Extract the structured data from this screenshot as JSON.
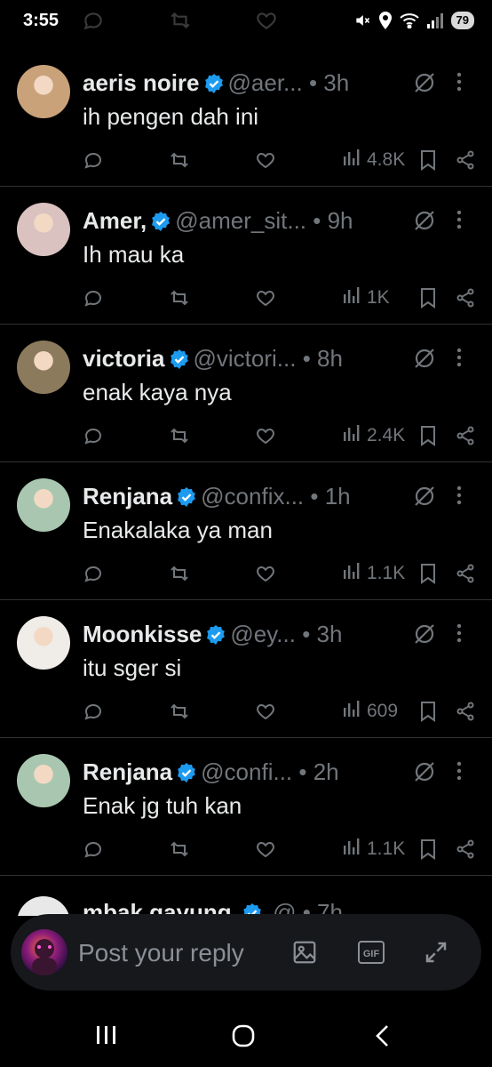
{
  "status_bar": {
    "time": "3:55",
    "battery": "79"
  },
  "tweets": [
    {
      "name": "aeris noire",
      "handle": "@aer...",
      "ago": "3h",
      "text": "ih pengen dah ini",
      "views": "4.8K",
      "avatar_color": "#c9a27a"
    },
    {
      "name": "Amer,",
      "handle": "@amer_sit...",
      "ago": "9h",
      "text": "Ih mau ka",
      "views": "1K",
      "avatar_color": "#d9c2c0"
    },
    {
      "name": "victoria",
      "handle": "@victori...",
      "ago": "8h",
      "text": "enak kaya nya",
      "views": "2.4K",
      "avatar_color": "#8c7a5c"
    },
    {
      "name": "Renjana",
      "handle": "@confix...",
      "ago": "1h",
      "text": "Enakalaka ya man",
      "views": "1.1K",
      "avatar_color": "#a9c7b0"
    },
    {
      "name": "Moonkisse",
      "handle": "@ey...",
      "ago": "3h",
      "text": "itu sger si",
      "views": "609",
      "avatar_color": "#f0ece8"
    },
    {
      "name": "Renjana",
      "handle": "@confi...",
      "ago": "2h",
      "text": "Enak jg tuh kan",
      "views": "1.1K",
      "avatar_color": "#a9c7b0"
    }
  ],
  "partial_tweet": {
    "name": "mbak gayung",
    "handle": "@",
    "ago": "7h"
  },
  "reply": {
    "placeholder": "Post your reply",
    "gif_label": "GIF"
  },
  "colors": {
    "background": "#000000",
    "verified": "#1d9bf0",
    "muted": "#71767b",
    "text": "#e7e9ea"
  },
  "icons": [
    "reply-icon",
    "retweet-icon",
    "like-icon",
    "views-icon",
    "bookmark-icon",
    "share-icon",
    "grok-icon",
    "more-icon",
    "image-icon",
    "gif-icon",
    "expand-icon"
  ]
}
